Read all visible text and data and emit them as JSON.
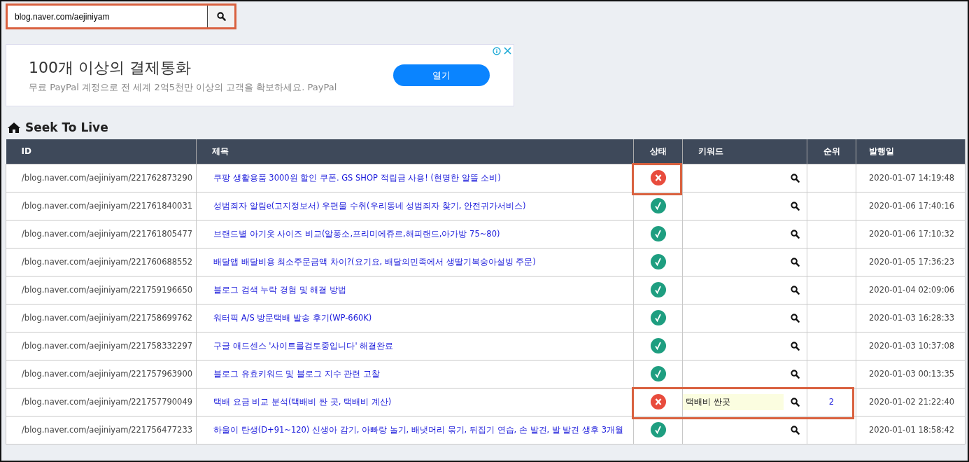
{
  "search": {
    "value": "blog.naver.com/aejiniyam",
    "highlighted": true
  },
  "ad": {
    "headline": "100개 이상의 결제통화",
    "text": "무료 PayPal 계정으로 전 세계 2억5천만 이상의 고객을 확보하세요. PayPal",
    "button": "열기"
  },
  "heading": "Seek To Live",
  "table": {
    "columns": [
      "ID",
      "제목",
      "상태",
      "키워드",
      "순위",
      "발행일"
    ],
    "rows": [
      {
        "id": "/blog.naver.com/aejiniyam/221762873290",
        "title": "쿠팡 생활용품 3000원 할인 쿠폰. GS SHOP 적립금 사용! (현명한 알뜰 소비)",
        "ok": false,
        "date": "2020-01-07 14:19:48",
        "frame_status": true,
        "frame_status_to_rank": false
      },
      {
        "id": "/blog.naver.com/aejiniyam/221761840031",
        "title": "성범죄자 알림e(고지정보서) 우편물 수취(우리동네 성범죄자 찾기, 안전귀가서비스)",
        "ok": true,
        "date": "2020-01-06 17:40:16",
        "frame_status": false,
        "frame_status_to_rank": false
      },
      {
        "id": "/blog.naver.com/aejiniyam/221761805477",
        "title": "브랜드별 아기옷 사이즈 비교(알퐁소,프리미에쥬르,해피랜드,아가방 75~80)",
        "ok": true,
        "date": "2020-01-06 17:10:32",
        "frame_status": false,
        "frame_status_to_rank": false
      },
      {
        "id": "/blog.naver.com/aejiniyam/221760688552",
        "title": "배달앱 배달비용 최소주문금액 차이?(요기요, 배달의민족에서 생딸기복숭아설빙 주문)",
        "ok": true,
        "date": "2020-01-05 17:36:23",
        "frame_status": false,
        "frame_status_to_rank": false
      },
      {
        "id": "/blog.naver.com/aejiniyam/221759196650",
        "title": "블로그 검색 누락 경험 및 해결 방법",
        "ok": true,
        "date": "2020-01-04 02:09:06",
        "frame_status": false,
        "frame_status_to_rank": false
      },
      {
        "id": "/blog.naver.com/aejiniyam/221758699762",
        "title": "워터픽 A/S 방문택배 발송 후기(WP-660K)",
        "ok": true,
        "date": "2020-01-03 16:28:33",
        "frame_status": false,
        "frame_status_to_rank": false
      },
      {
        "id": "/blog.naver.com/aejiniyam/221758332297",
        "title": "구글 애드센스 '사이트를검토중입니다' 해결완료",
        "ok": true,
        "date": "2020-01-03 10:37:08",
        "frame_status": false,
        "frame_status_to_rank": false
      },
      {
        "id": "/blog.naver.com/aejiniyam/221757963900",
        "title": "블로그 유효키워드 및 블로그 지수 관련 고찰",
        "ok": true,
        "date": "2020-01-03 00:13:35",
        "frame_status": false,
        "frame_status_to_rank": false
      },
      {
        "id": "/blog.naver.com/aejiniyam/221757790049",
        "title": "택배 요금 비교 분석(택배비 싼 곳, 택배비 계산)",
        "ok": false,
        "keyword": "택배비 싼곳",
        "rank": "2",
        "date": "2020-01-02 21:22:40",
        "frame_status": false,
        "frame_status_to_rank": true
      },
      {
        "id": "/blog.naver.com/aejiniyam/221756477233",
        "title": "하울이 탄생(D+91~120) 신생아 감기, 아빠랑 놀기, 배냇머리 묶기, 뒤집기 연습, 손 발견, 발 발견 생후 3개월",
        "ok": true,
        "date": "2020-01-01 18:58:42",
        "frame_status": false,
        "frame_status_to_rank": false
      }
    ]
  }
}
